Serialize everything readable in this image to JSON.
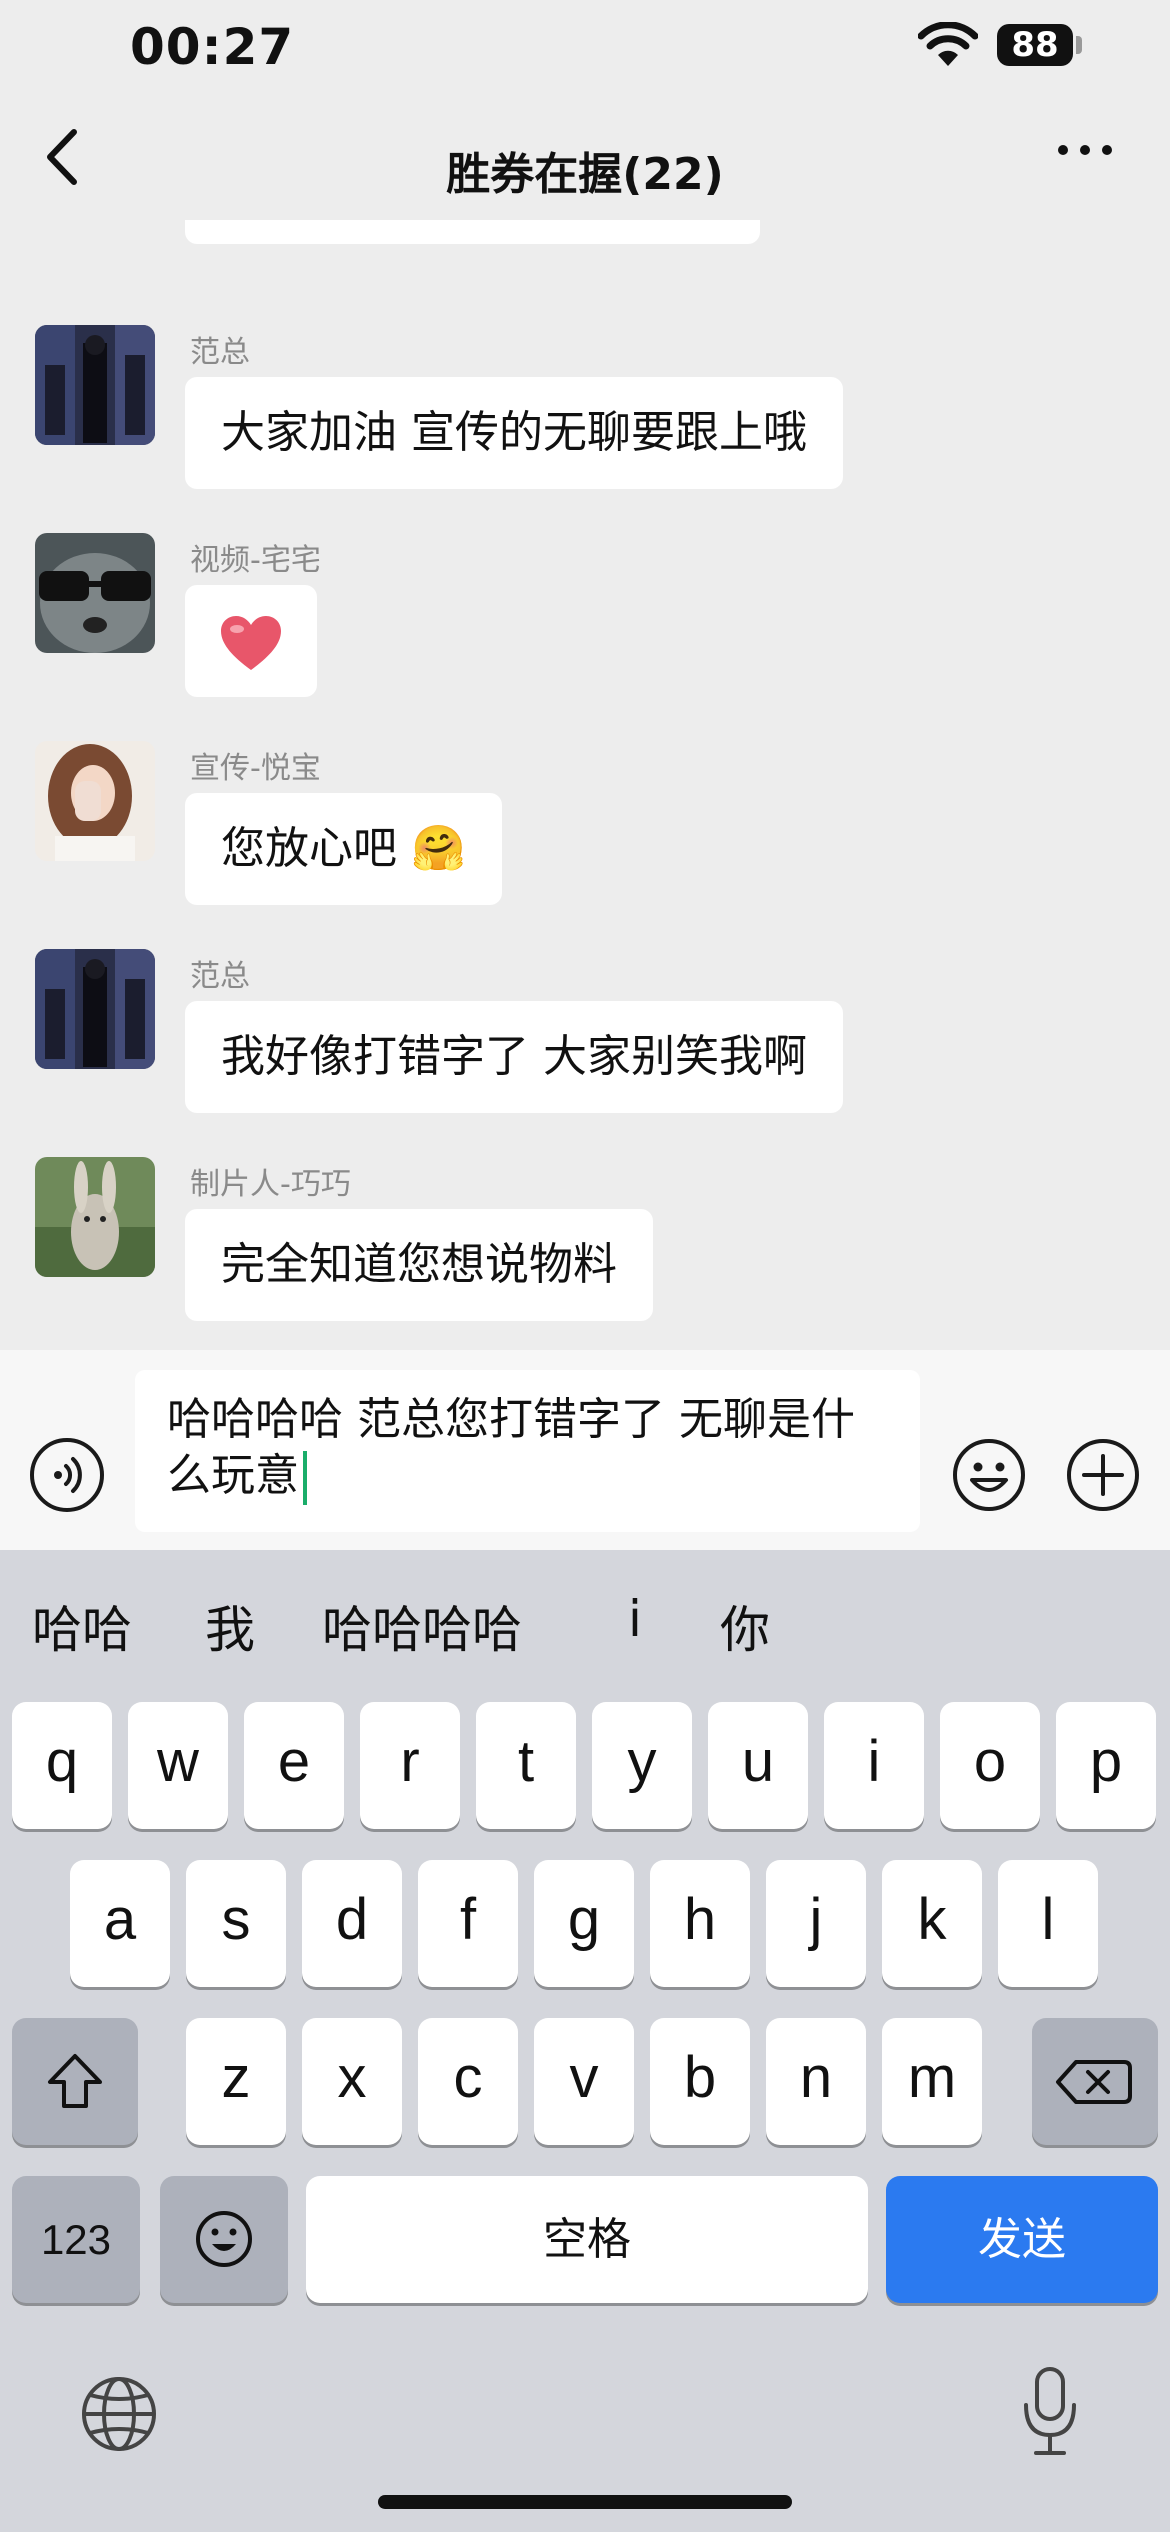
{
  "status_bar": {
    "time": "00:27",
    "battery": "88"
  },
  "nav": {
    "title": "胜券在握(22)"
  },
  "messages": [
    {
      "sender": "范总",
      "text": "大家加油 宣传的无聊要跟上哦",
      "avatar": "dark-movie-poster"
    },
    {
      "sender": "视频-宅宅",
      "text": "❤️",
      "avatar": "dog-with-sunglasses"
    },
    {
      "sender": "宣传-悦宝",
      "text": "您放心吧 🤗",
      "avatar": "woman-photo"
    },
    {
      "sender": "范总",
      "text": "我好像打错字了 大家别笑我啊",
      "avatar": "dark-movie-poster"
    },
    {
      "sender": "制片人-巧巧",
      "text": "完全知道您想说物料",
      "avatar": "rabbit-photo"
    }
  ],
  "input": {
    "value": "哈哈哈哈 范总您打错字了 无聊是什么玩意"
  },
  "keyboard": {
    "suggestions": [
      "哈哈",
      "我",
      "哈哈哈哈",
      "i",
      "你"
    ],
    "row1": [
      "q",
      "w",
      "e",
      "r",
      "t",
      "y",
      "u",
      "i",
      "o",
      "p"
    ],
    "row2": [
      "a",
      "s",
      "d",
      "f",
      "g",
      "h",
      "j",
      "k",
      "l"
    ],
    "row3": [
      "z",
      "x",
      "c",
      "v",
      "b",
      "n",
      "m"
    ],
    "numbers_label": "123",
    "space_label": "空格",
    "send_label": "发送"
  },
  "colors": {
    "background": "#ededed",
    "send": "#2b7af0",
    "cursor": "#1aad6a"
  }
}
